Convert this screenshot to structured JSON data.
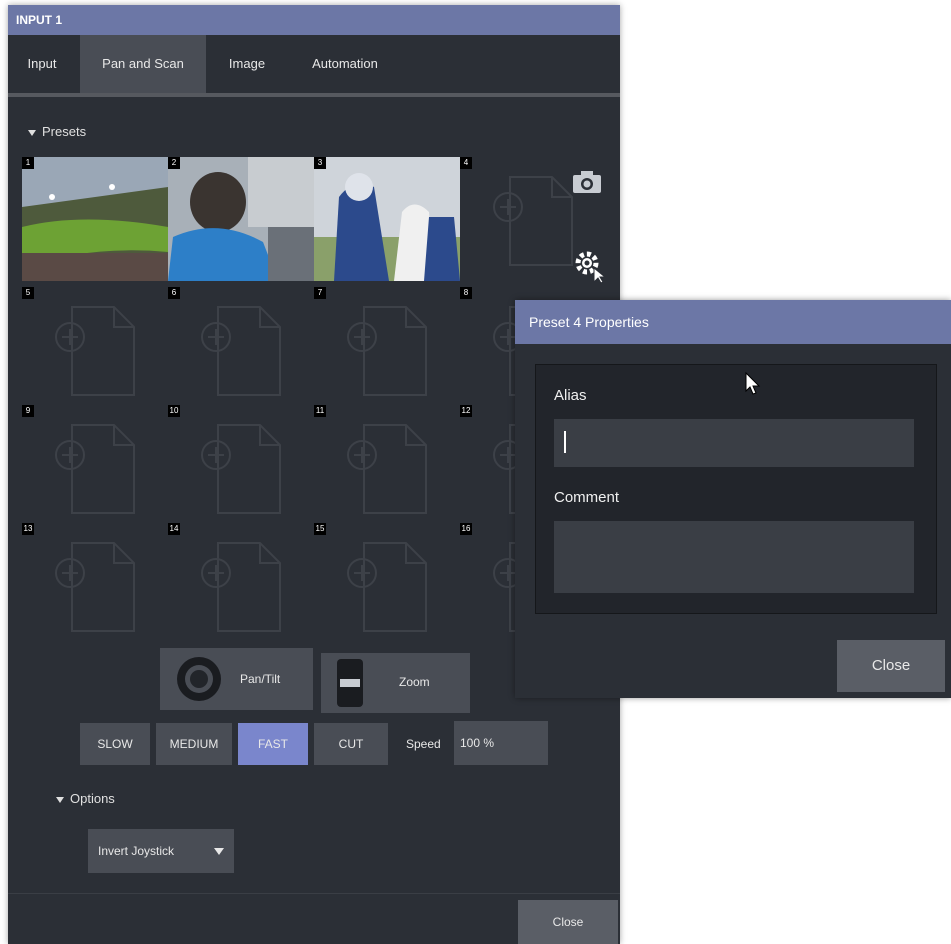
{
  "window": {
    "title": "INPUT 1",
    "tabs": [
      {
        "label": "Input",
        "active": false
      },
      {
        "label": "Pan and Scan",
        "active": true
      },
      {
        "label": "Image",
        "active": false
      },
      {
        "label": "Automation",
        "active": false
      }
    ],
    "presets_label": "Presets",
    "preset_numbers": [
      "1",
      "2",
      "3",
      "4",
      "5",
      "6",
      "7",
      "8",
      "9",
      "10",
      "11",
      "12",
      "13",
      "14",
      "15",
      "16"
    ],
    "controls": {
      "pantilt_label": "Pan/Tilt",
      "zoom_label": "Zoom",
      "speed_buttons": [
        {
          "label": "SLOW",
          "active": false
        },
        {
          "label": "MEDIUM",
          "active": false
        },
        {
          "label": "FAST",
          "active": true
        },
        {
          "label": "CUT",
          "active": false
        }
      ],
      "speed_label": "Speed",
      "speed_value": "100 %"
    },
    "options_label": "Options",
    "options_dropdown": "Invert Joystick",
    "close_label": "Close"
  },
  "dialog": {
    "title": "Preset 4 Properties",
    "alias_label": "Alias",
    "alias_value": "",
    "comment_label": "Comment",
    "comment_value": "",
    "close_label": "Close"
  },
  "colors": {
    "accent": "#6c77a6",
    "active_speed": "#7a86cc",
    "panel": "#2b2f36",
    "button": "#494d55"
  }
}
